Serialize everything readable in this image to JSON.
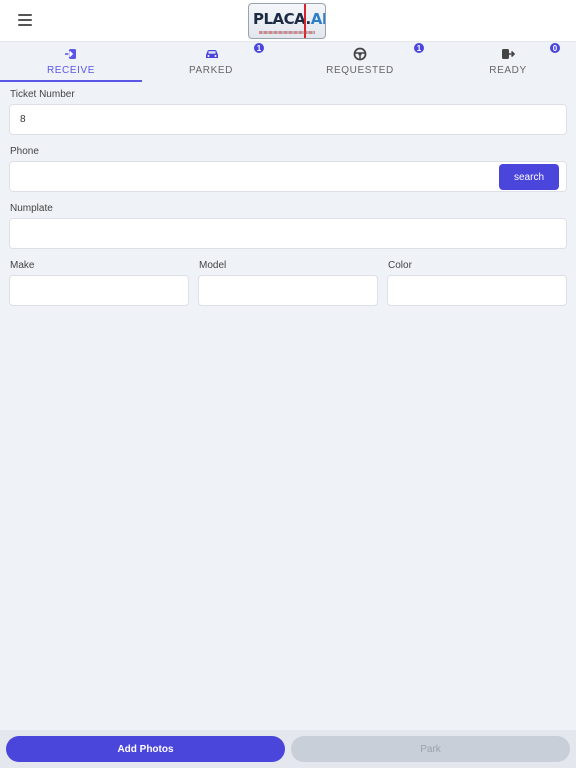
{
  "header": {
    "menu_icon": "hamburger-menu-icon",
    "logo_text_main": "PLACA.",
    "logo_text_accent": "AI"
  },
  "tabs": [
    {
      "label": "RECEIVE",
      "icon": "sign-in-icon",
      "active": true
    },
    {
      "label": "PARKED",
      "icon": "car-icon",
      "badge": "1"
    },
    {
      "label": "REQUESTED",
      "icon": "steering-wheel-icon",
      "badge": "1"
    },
    {
      "label": "READY",
      "icon": "sign-out-icon",
      "badge": "0"
    }
  ],
  "form": {
    "ticket_label": "Ticket Number",
    "ticket_value": "8",
    "phone_label": "Phone",
    "phone_value": "",
    "search_label": "search",
    "numplate_label": "Numplate",
    "numplate_value": "",
    "make_label": "Make",
    "make_value": "",
    "model_label": "Model",
    "model_value": "",
    "color_label": "Color",
    "color_value": ""
  },
  "footer": {
    "add_photos_label": "Add Photos",
    "park_label": "Park"
  },
  "colors": {
    "accent": "#4a46dc",
    "background": "#eff2f7"
  }
}
